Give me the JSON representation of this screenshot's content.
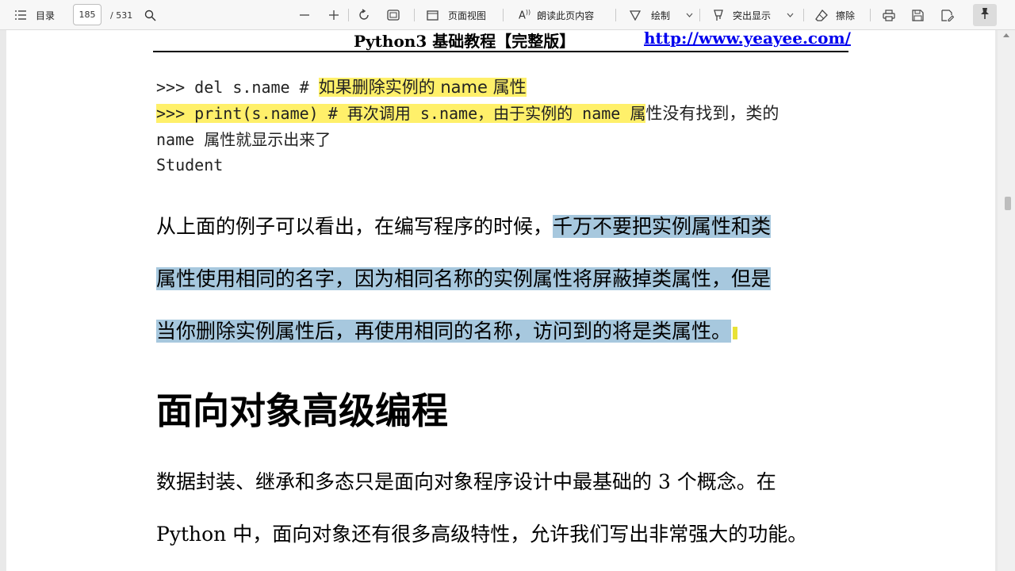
{
  "toolbar": {
    "toc_label": "目录",
    "current_page": "185",
    "total_pages": "/ 531",
    "page_view_label": "页面视图",
    "read_aloud_label": "朗读此页内容",
    "draw_label": "绘制",
    "highlight_label": "突出显示",
    "erase_label": "擦除"
  },
  "document": {
    "header_title": "Python3 基础教程【完整版】",
    "header_url": "http://www.yeayee.com/",
    "code_line1_a": ">>> del s.name # ",
    "code_line1_b": "如果删除实例的 name 属性",
    "code_line2_a": ">>> print(s.name) # 再次调用 s.name，由于实例的 name 属",
    "code_line2_b": "性没有找到，类的",
    "code_line3": "name 属性就显示出来了",
    "code_line4": "Student",
    "para1_line1_a": "从上面的例子可以看出，在编写程序的时候，",
    "para1_line1_b": "千万不要把实例属性和类",
    "para1_line2": "属性使用相同的名字，因为相同名称的实例属性将屏蔽掉类属性，但是",
    "para1_line3": "当你删除实例属性后，再使用相同的名称，访问到的将是类属性。",
    "heading": "面向对象高级编程",
    "para2_line1": "数据封装、继承和多态只是面向对象程序设计中最基础的 3 个概念。在",
    "para2_line2": "Python 中，面向对象还有很多高级特性，允许我们写出非常强大的功能。"
  },
  "colors": {
    "yellow_highlight": "#fff06a",
    "blue_highlight": "#a7c8de",
    "link": "#0000ee"
  }
}
